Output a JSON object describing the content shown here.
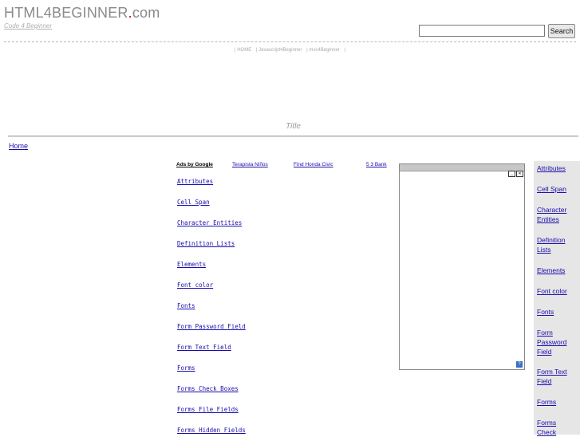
{
  "header": {
    "logo_main": "HTML4BEGINNER",
    "logo_dot": ".",
    "logo_tld": "com",
    "tagline": "Code 4 Beginner",
    "search_button": "Search",
    "search_value": ""
  },
  "topnav": {
    "items": [
      "| HOME",
      "| Javascript4Beginner",
      "| mvc4Beginner",
      "|"
    ]
  },
  "page": {
    "title": "Title",
    "breadcrumb": "Home"
  },
  "ads": {
    "label": "Ads by Google",
    "links": [
      "Terapista Niños",
      "Find Honda Civic",
      "5 3 Bank"
    ]
  },
  "main_links": [
    "Attributes",
    "Cell Span",
    "Character Entities",
    "Definition Lists",
    "Elements",
    "Font color",
    "Fonts",
    "Form Password Field",
    "Form Text Field",
    "Forms",
    "Forms Check Boxes",
    "Forms File Fields",
    "Forms Hidden Fields"
  ],
  "side_links": [
    [
      "Attributes"
    ],
    [
      "Cell Span"
    ],
    [
      "Character",
      "Entities"
    ],
    [
      "Definition",
      "Lists"
    ],
    [
      "Elements"
    ],
    [
      "Font color"
    ],
    [
      "Fonts"
    ],
    [
      "Form",
      "Password",
      "Field"
    ],
    [
      "Form Text",
      "Field"
    ],
    [
      "Forms"
    ],
    [
      "Forms",
      "Check"
    ]
  ],
  "colors": {
    "link": "#1a0dab",
    "logo_dot": "#d40000",
    "sidebar_bg": "#e6e6e6"
  }
}
